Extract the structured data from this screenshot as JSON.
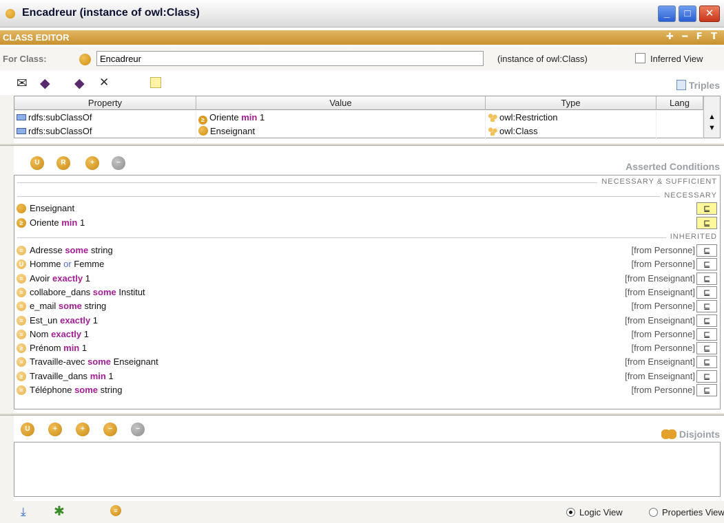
{
  "window": {
    "title": "Encadreur   (instance of owl:Class)",
    "buttons": {
      "minimize": "_",
      "maximize": "□",
      "close": "✕"
    }
  },
  "editor": {
    "header": "CLASS EDITOR",
    "header_icons": "✚ ━ F T",
    "for_class_label": "For Class:",
    "class_name": "Encadreur",
    "instance_of": "(instance of owl:Class)",
    "inferred_view": "Inferred View"
  },
  "triples": {
    "label": "Triples",
    "columns": [
      "Property",
      "Value",
      "Type",
      "Lang"
    ],
    "rows": [
      {
        "property": "rdfs:subClassOf",
        "value_pre": "Oriente ",
        "value_kw": "min",
        "value_post": " 1",
        "type": "owl:Restriction",
        "lang": ""
      },
      {
        "property": "rdfs:subClassOf",
        "value_pre": "Enseignant",
        "value_kw": "",
        "value_post": "",
        "type": "owl:Class",
        "lang": ""
      }
    ]
  },
  "conditions": {
    "title": "Asserted Conditions",
    "sections": {
      "nec_suf": "NECESSARY & SUFFICIENT",
      "necessary": "NECESSARY",
      "inherited": "INHERITED"
    },
    "subclass_symbol": "⊑",
    "necessary": [
      {
        "pre": "Enseignant",
        "kw": "",
        "post": ""
      },
      {
        "pre": "Oriente ",
        "kw": "min",
        "post": " 1"
      }
    ],
    "inherited": [
      {
        "pre": "Adresse ",
        "kw": "some",
        "post": " string",
        "from": "[from Personne]"
      },
      {
        "pre": "Homme ",
        "kw": "or",
        "post": " Femme",
        "from": "[from Personne]"
      },
      {
        "pre": "Avoir ",
        "kw": "exactly",
        "post": " 1",
        "from": "[from Enseignant]"
      },
      {
        "pre": "collabore_dans ",
        "kw": "some",
        "post": " Institut",
        "from": "[from Enseignant]"
      },
      {
        "pre": "e_mail ",
        "kw": "some",
        "post": " string",
        "from": "[from Personne]"
      },
      {
        "pre": "Est_un ",
        "kw": "exactly",
        "post": " 1",
        "from": "[from Enseignant]"
      },
      {
        "pre": "Nom ",
        "kw": "exactly",
        "post": " 1",
        "from": "[from Personne]"
      },
      {
        "pre": "Prénom ",
        "kw": "min",
        "post": " 1",
        "from": "[from Personne]"
      },
      {
        "pre": "Travaille-avec ",
        "kw": "some",
        "post": " Enseignant",
        "from": "[from Enseignant]"
      },
      {
        "pre": "Travaille_dans ",
        "kw": "min",
        "post": " 1",
        "from": "[from Enseignant]"
      },
      {
        "pre": "Téléphone ",
        "kw": "some",
        "post": " string",
        "from": "[from Personne]"
      }
    ]
  },
  "disjoints": {
    "title": "Disjoints"
  },
  "views": {
    "logic": "Logic View",
    "properties": "Properties View",
    "selected": "logic"
  }
}
